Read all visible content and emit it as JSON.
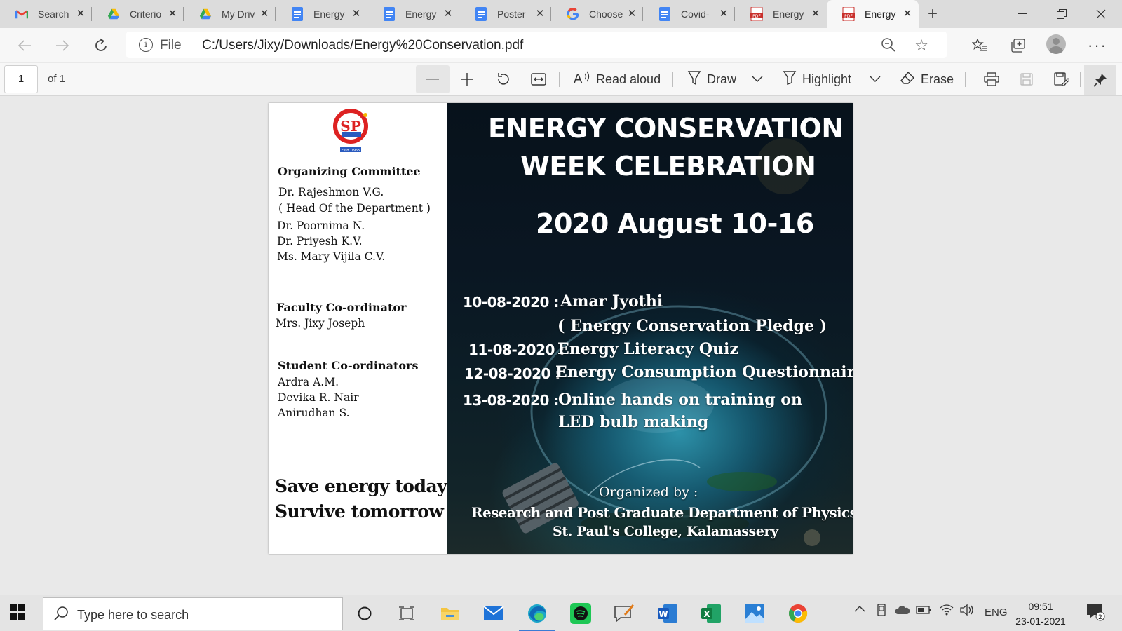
{
  "tabs": [
    {
      "title": "Search",
      "icon": "gmail-icon"
    },
    {
      "title": "Criterio",
      "icon": "google-drive-icon"
    },
    {
      "title": "My Driv",
      "icon": "google-drive-icon"
    },
    {
      "title": "Energy",
      "icon": "google-docs-icon"
    },
    {
      "title": "Energy",
      "icon": "google-docs-icon"
    },
    {
      "title": "Poster",
      "icon": "google-docs-icon"
    },
    {
      "title": "Choose",
      "icon": "google-icon"
    },
    {
      "title": "Covid-",
      "icon": "google-docs-icon"
    },
    {
      "title": "Energy",
      "icon": "pdf-icon"
    },
    {
      "title": "Energy",
      "icon": "pdf-icon",
      "active": true
    }
  ],
  "address": {
    "scheme": "File",
    "url": "C:/Users/Jixy/Downloads/Energy%20Conservation.pdf"
  },
  "pdf_toolbar": {
    "page_number": "1",
    "page_of": "of 1",
    "read_aloud": "Read aloud",
    "draw": "Draw",
    "highlight": "Highlight",
    "erase": "Erase"
  },
  "document": {
    "organizing_committee": {
      "heading": "Organizing Committee",
      "members": [
        "Dr. Rajeshmon V.G.",
        "( Head Of the Department )",
        "Dr. Poornima N.",
        "Dr. Priyesh K.V.",
        "Ms. Mary Vijila C.V."
      ]
    },
    "faculty_coordinator": {
      "heading": "Faculty Co-ordinator",
      "name": "Mrs. Jixy Joseph"
    },
    "student_coordinators": {
      "heading": "Student Co-ordinators",
      "names": [
        "Ardra A.M.",
        "Devika R. Nair",
        "Anirudhan S."
      ]
    },
    "slogan": [
      "Save energy today ;",
      "Survive tomorrow"
    ],
    "logo_text": "Estd. 1965",
    "poster": {
      "title_line1": "ENERGY CONSERVATION",
      "title_line2": "WEEK CELEBRATION",
      "dates": "2020 August 10-16",
      "events": [
        {
          "date": "10-08-2020 :",
          "lines": [
            "Amar Jyothi",
            "( Energy Conservation Pledge )"
          ]
        },
        {
          "date": "11-08-2020 :",
          "lines": [
            "Energy Literacy Quiz"
          ]
        },
        {
          "date": "12-08-2020 :",
          "lines": [
            "Energy Consumption Questionnaire"
          ]
        },
        {
          "date": "13-08-2020 :",
          "lines": [
            "Online hands on training on",
            "LED bulb making"
          ]
        }
      ],
      "organized_by": "Organized by :",
      "department": "Research and Post Graduate Department of Physics",
      "college": "St. Paul's College, Kalamassery"
    }
  },
  "taskbar": {
    "search_placeholder": "Type here to search",
    "apps": [
      "cortana-icon",
      "task-view-icon",
      "file-explorer-icon",
      "mail-icon",
      "edge-icon",
      "spotify-icon",
      "snip-sketch-icon",
      "word-icon",
      "excel-icon",
      "photos-icon",
      "chrome-icon"
    ],
    "language": "ENG",
    "time": "09:51",
    "date": "23-01-2021",
    "notification_count": "2"
  }
}
